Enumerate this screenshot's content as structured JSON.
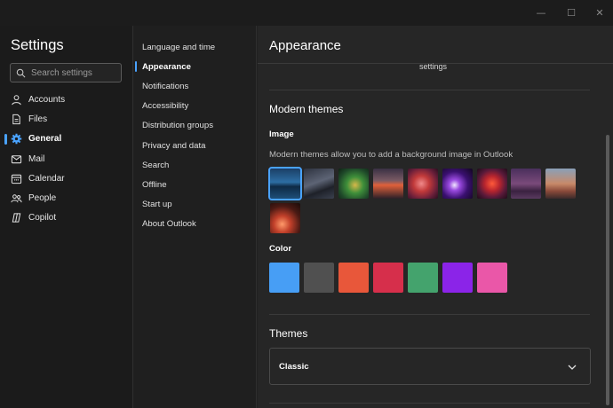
{
  "window": {
    "minimize_glyph": "—",
    "maximize_glyph": "☐",
    "close_glyph": "✕"
  },
  "sidebar": {
    "title": "Settings",
    "search_placeholder": "Search settings",
    "items": [
      {
        "label": "Accounts",
        "icon": "person-icon"
      },
      {
        "label": "Files",
        "icon": "file-icon"
      },
      {
        "label": "General",
        "icon": "gear-icon",
        "active": true
      },
      {
        "label": "Mail",
        "icon": "mail-icon"
      },
      {
        "label": "Calendar",
        "icon": "calendar-icon"
      },
      {
        "label": "People",
        "icon": "people-icon"
      },
      {
        "label": "Copilot",
        "icon": "copilot-icon"
      }
    ]
  },
  "submenu": {
    "items": [
      {
        "label": "Language and time"
      },
      {
        "label": "Appearance",
        "active": true
      },
      {
        "label": "Notifications"
      },
      {
        "label": "Accessibility"
      },
      {
        "label": "Distribution groups"
      },
      {
        "label": "Privacy and data"
      },
      {
        "label": "Search"
      },
      {
        "label": "Offline"
      },
      {
        "label": "Start up"
      },
      {
        "label": "About Outlook"
      }
    ]
  },
  "main": {
    "title": "Appearance",
    "partial_label": "settings",
    "modern_themes": {
      "title": "Modern themes",
      "image_label": "Image",
      "image_description": "Modern themes allow you to add a background image in Outlook",
      "thumbnails": [
        {
          "name": "mountain-lake",
          "selected": true
        },
        {
          "name": "dark-waves"
        },
        {
          "name": "green-swirl"
        },
        {
          "name": "bird-sunset"
        },
        {
          "name": "red-swirl"
        },
        {
          "name": "purple-orbs"
        },
        {
          "name": "red-abstract"
        },
        {
          "name": "purple-dunes"
        },
        {
          "name": "desert-dunes"
        },
        {
          "name": "red-arch"
        }
      ],
      "color_label": "Color",
      "colors": [
        "#479ef5",
        "#505050",
        "#e8573a",
        "#d62f4b",
        "#44a36d",
        "#8b24e8",
        "#ea57a8"
      ]
    },
    "themes": {
      "title": "Themes",
      "selected": "Classic"
    }
  }
}
